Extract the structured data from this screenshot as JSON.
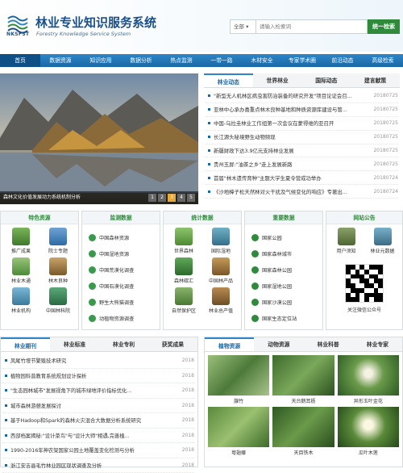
{
  "header": {
    "title": "林业专业知识服务系统",
    "subtitle": "Forestry Knowledge Service System",
    "logo_text": "NKSFST",
    "search_scope": "全部",
    "search_placeholder": "请输入检索词",
    "search_button": "统一检索"
  },
  "nav": [
    "首页",
    "数据资源",
    "知识应用",
    "数据分析",
    "热点监测",
    "一带一路",
    "木材安全",
    "专家学术圈",
    "前沿动态",
    "高级检索"
  ],
  "banner": {
    "caption": "森林文化价值发展动力系统机制分析",
    "pages": [
      "1",
      "2",
      "3",
      "4",
      "5"
    ],
    "active_page": 3
  },
  "news": {
    "tabs": [
      "林业动态",
      "世界林业",
      "国际动态",
      "建言献策"
    ],
    "items": [
      {
        "t": "\"新型无人机林区病虫害防治装备的研究开发\"项目论证会召...",
        "d": "20180725"
      },
      {
        "t": "亚林中心承办喜重点林木良种基地和种质资源库建设与管...",
        "d": "20180725"
      },
      {
        "t": "中国-乌拉圭林业工作组第一次会议在蒙得维的亚召开",
        "d": "20180725"
      },
      {
        "t": "长江源头秘境野生动物频现",
        "d": "20180725"
      },
      {
        "t": "新疆财政下达3.9亿元支持林业发展",
        "d": "20180725"
      },
      {
        "t": "贵州玉屏:\"油茶之乡\"走上发展新路",
        "d": "20180725"
      },
      {
        "t": "首届\"林木遗传育种\"主题大学生夏令营成功举办",
        "d": "20180724"
      },
      {
        "t": "《沙地樟子松天然林对火干扰及气候变化的响应》专著出...",
        "d": "20180724"
      }
    ]
  },
  "panels": {
    "special": {
      "title": "特色资源",
      "items": [
        "推广成果",
        "院士专题",
        "林业木通",
        "林木良种",
        "林业机构",
        "中国林科院"
      ]
    },
    "monitor": {
      "title": "监测数据",
      "items": [
        "中国森林资源",
        "中国湿地资源",
        "中国荒漠化调查",
        "中国石漠化调查",
        "野生大熊猫调查",
        "动植物资源调查"
      ]
    },
    "stats": {
      "title": "统计数据",
      "items": [
        "世界森林",
        "国际湿地",
        "森林碳汇",
        "中国林产品",
        "自然保护区",
        "林业总产值"
      ]
    },
    "key": {
      "title": "重要数据",
      "items": [
        "国家公园",
        "国家森林城市",
        "国家森林公园",
        "国家湿地公园",
        "国家沙漠公园",
        "国家生态定位站"
      ]
    },
    "notice": {
      "title": "网站公告",
      "items": [
        "用户须知",
        "林业元数据"
      ],
      "qr_caption": "关注微信公众号"
    }
  },
  "bottom_left": {
    "tabs": [
      "林业期刊",
      "林业标准",
      "林业专利",
      "获奖成果"
    ],
    "items": [
      {
        "t": "凤尾竹增节繁殖技术研究",
        "d": "2018"
      },
      {
        "t": "植物园科普教育系统规划设计探析",
        "d": "2018"
      },
      {
        "t": "\"生态园林城市\"发展视角下的城市绿地评价指标优化...",
        "d": "2018"
      },
      {
        "t": "城市森林游憩发展探讨",
        "d": "2018"
      },
      {
        "t": "基于Hadoop和Spark的森林火灾混合大数据分析系统研究",
        "d": "2018"
      },
      {
        "t": "西部档案揭秘:\"设计菜鸟\"与\"设计大师\"相遇,完善植...",
        "d": "2018"
      },
      {
        "t": "1990-2016年神农架国家公园土地覆盖变化检测与分析",
        "d": "2018"
      },
      {
        "t": "浙江安吉县毛竹林业园区现状调查及分析",
        "d": "2018"
      }
    ]
  },
  "bottom_right": {
    "tabs": [
      "植物资源",
      "动物资源",
      "林业科普",
      "林业专家"
    ],
    "items": [
      "腺竹",
      "天台鹅耳枥",
      "异形玉叶金花",
      "萼翅藤",
      "天目铁木",
      "瓜叶木莲"
    ]
  },
  "colors": {
    "brand": "#1a4f8a",
    "nav": "#1a67a6",
    "accent_green": "#2f8a3c",
    "highlight": "#e7a93b"
  }
}
